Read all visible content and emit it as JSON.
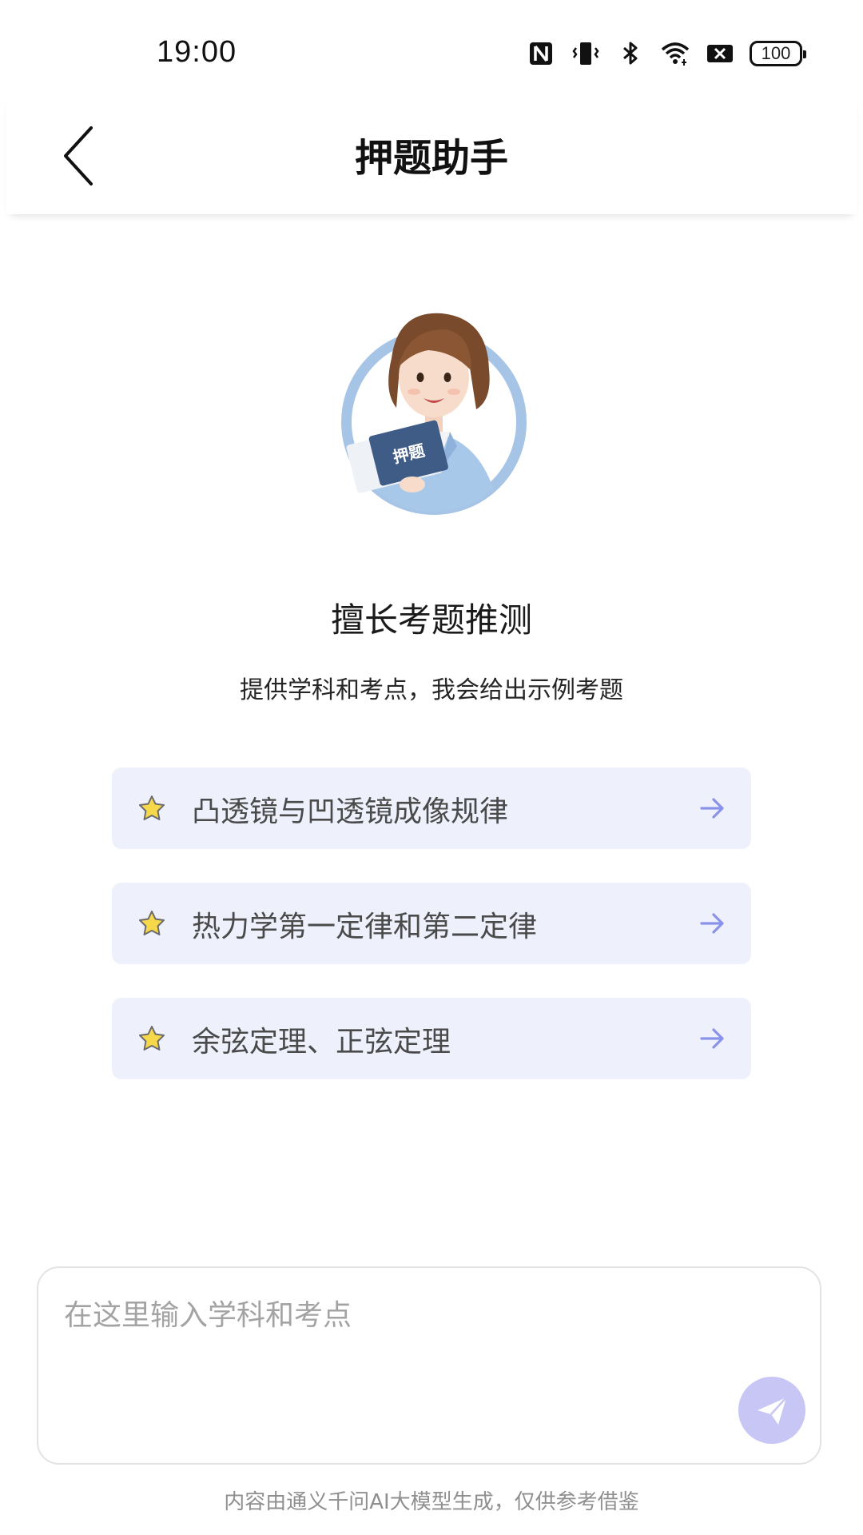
{
  "status_bar": {
    "time": "19:00",
    "battery": "100",
    "icons": [
      "nfc-icon",
      "vibrate-icon",
      "bluetooth-icon",
      "wifi-icon",
      "no-sim-icon",
      "battery-icon"
    ]
  },
  "header": {
    "title": "押题助手",
    "back_icon": "chevron-left-icon"
  },
  "avatar": {
    "book_text": "押题"
  },
  "intro": {
    "headline": "擅长考题推测",
    "subline": "提供学科和考点，我会给出示例考题"
  },
  "suggestions": [
    {
      "label": "凸透镜与凹透镜成像规律",
      "icon": "star-icon",
      "arrow": "arrow-right-icon"
    },
    {
      "label": "热力学第一定律和第二定律",
      "icon": "star-icon",
      "arrow": "arrow-right-icon"
    },
    {
      "label": "余弦定理、正弦定理",
      "icon": "star-icon",
      "arrow": "arrow-right-icon"
    }
  ],
  "input": {
    "placeholder": "在这里输入学科和考点",
    "value": ""
  },
  "send": {
    "icon": "paper-plane-icon"
  },
  "footer": {
    "disclaimer": "内容由通义千问AI大模型生成，仅供参考借鉴"
  },
  "colors": {
    "card_bg": "#eef0fc",
    "arrow": "#8a93e8",
    "send_bg": "#c7c6f4",
    "avatar_ring": "#a6c4e6",
    "star": "#f5d94a"
  }
}
